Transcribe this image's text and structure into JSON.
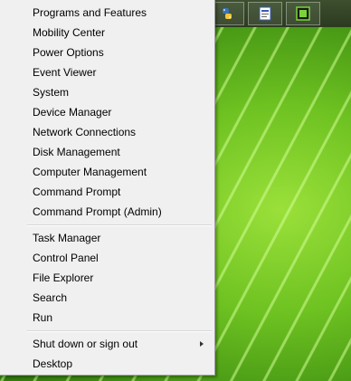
{
  "menu": {
    "group1": [
      "Programs and Features",
      "Mobility Center",
      "Power Options",
      "Event Viewer",
      "System",
      "Device Manager",
      "Network Connections",
      "Disk Management",
      "Computer Management",
      "Command Prompt",
      "Command Prompt (Admin)"
    ],
    "group2": [
      "Task Manager",
      "Control Panel",
      "File Explorer",
      "Search",
      "Run"
    ],
    "group3": [
      "Shut down or sign out",
      "Desktop"
    ]
  },
  "taskbar": {
    "icons": [
      "python-icon",
      "document-icon",
      "app-icon"
    ]
  }
}
